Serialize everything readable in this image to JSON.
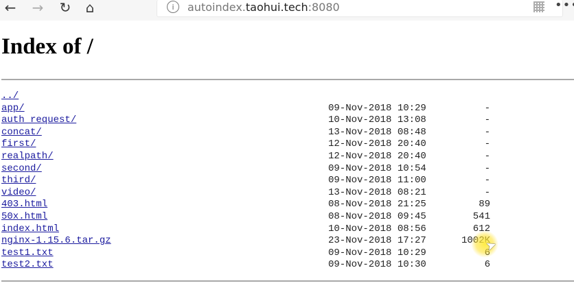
{
  "browser": {
    "back_icon": "arrow-left-icon",
    "forward_icon": "arrow-right-icon",
    "reload_icon": "reload-icon",
    "home_icon": "home-icon",
    "url_prefix": "autoindex.",
    "url_host": "taohui.tech",
    "url_port": ":8080"
  },
  "page": {
    "title": "Index of /"
  },
  "listing": {
    "entries": [
      {
        "name": "../",
        "date": "",
        "size": ""
      },
      {
        "name": "app/",
        "date": "09-Nov-2018 10:29",
        "size": "-"
      },
      {
        "name": "auth_request/",
        "date": "10-Nov-2018 13:08",
        "size": "-"
      },
      {
        "name": "concat/",
        "date": "13-Nov-2018 08:48",
        "size": "-"
      },
      {
        "name": "first/",
        "date": "12-Nov-2018 20:40",
        "size": "-"
      },
      {
        "name": "realpath/",
        "date": "12-Nov-2018 20:40",
        "size": "-"
      },
      {
        "name": "second/",
        "date": "09-Nov-2018 10:54",
        "size": "-"
      },
      {
        "name": "third/",
        "date": "09-Nov-2018 11:00",
        "size": "-"
      },
      {
        "name": "video/",
        "date": "13-Nov-2018 08:21",
        "size": "-"
      },
      {
        "name": "403.html",
        "date": "08-Nov-2018 21:25",
        "size": "89"
      },
      {
        "name": "50x.html",
        "date": "08-Nov-2018 09:45",
        "size": "541"
      },
      {
        "name": "index.html",
        "date": "10-Nov-2018 08:56",
        "size": "612"
      },
      {
        "name": "nginx-1.15.6.tar.gz",
        "date": "23-Nov-2018 17:27",
        "size": "1002K"
      },
      {
        "name": "test1.txt",
        "date": "09-Nov-2018 10:29",
        "size": "6"
      },
      {
        "name": "test2.txt",
        "date": "09-Nov-2018 10:30",
        "size": "6"
      }
    ]
  }
}
